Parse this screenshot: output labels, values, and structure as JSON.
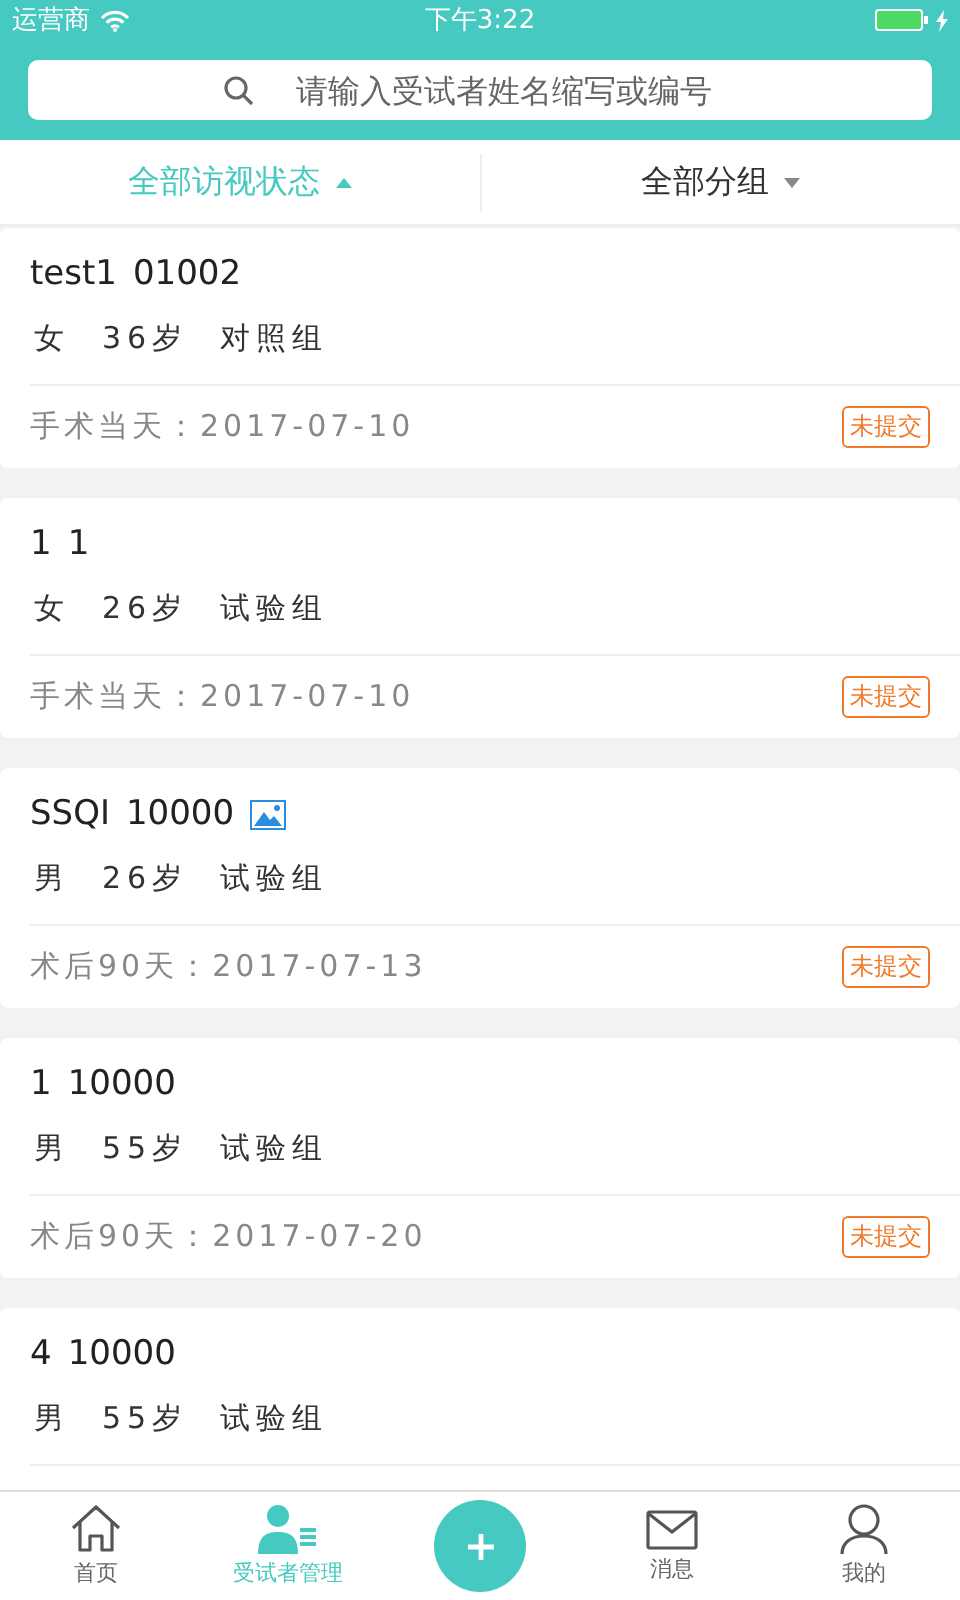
{
  "status_bar": {
    "carrier": "运营商",
    "time": "下午3:22"
  },
  "search": {
    "placeholder": "请输入受试者姓名缩写或编号"
  },
  "filters": [
    {
      "label": "全部访视状态",
      "selected": true
    },
    {
      "label": "全部分组",
      "selected": false
    }
  ],
  "subjects": [
    {
      "name": "test1",
      "code": "01002",
      "has_image": false,
      "sex": "女",
      "age": "36岁",
      "group": "对照组",
      "visit": "手术当天：2017-07-10",
      "status": "未提交"
    },
    {
      "name": "1",
      "code": "1",
      "has_image": false,
      "sex": "女",
      "age": "26岁",
      "group": "试验组",
      "visit": "手术当天：2017-07-10",
      "status": "未提交"
    },
    {
      "name": "SSQI",
      "code": "10000",
      "has_image": true,
      "sex": "男",
      "age": "26岁",
      "group": "试验组",
      "visit": "术后90天：2017-07-13",
      "status": "未提交"
    },
    {
      "name": "1",
      "code": "10000",
      "has_image": false,
      "sex": "男",
      "age": "55岁",
      "group": "试验组",
      "visit": "术后90天：2017-07-20",
      "status": "未提交"
    },
    {
      "name": "4",
      "code": "10000",
      "has_image": false,
      "sex": "男",
      "age": "55岁",
      "group": "试验组"
    }
  ],
  "tabs": [
    {
      "kind": "home",
      "label": "首页",
      "selected": false
    },
    {
      "kind": "subjects",
      "label": "受试者管理",
      "selected": true
    },
    {
      "kind": "add",
      "selected": false
    },
    {
      "kind": "mail",
      "label": "消息",
      "selected": false
    },
    {
      "kind": "user",
      "label": "我的",
      "selected": false
    }
  ]
}
